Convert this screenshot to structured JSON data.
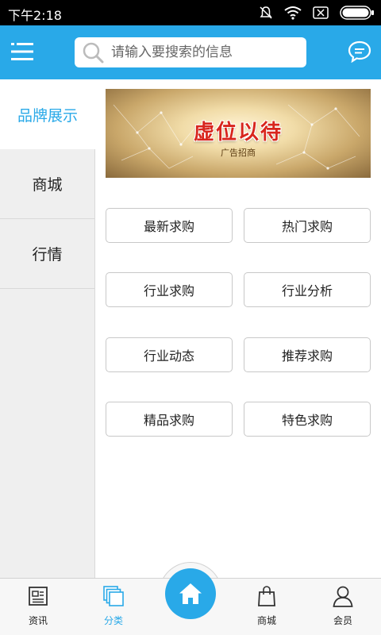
{
  "status_bar": {
    "time": "下午2:18",
    "battery_icon": "battery-icon",
    "wifi_icon": "wifi-icon",
    "mute_icon": "bell-off-icon",
    "sim_icon": "sim-off-icon"
  },
  "header": {
    "search": {
      "placeholder": "请输入要搜索的信息"
    },
    "menu_icon": "menu-icon",
    "message_icon": "chat-bubble-icon"
  },
  "sidebar": {
    "items": [
      {
        "label": "品牌展示",
        "active": true
      },
      {
        "label": "商城",
        "active": false
      },
      {
        "label": "行情",
        "active": false
      }
    ]
  },
  "banner": {
    "title": "虚位以待",
    "subtitle": "广告招商"
  },
  "categories": [
    {
      "label": "最新求购"
    },
    {
      "label": "热门求购"
    },
    {
      "label": "行业求购"
    },
    {
      "label": "行业分析"
    },
    {
      "label": "行业动态"
    },
    {
      "label": "推荐求购"
    },
    {
      "label": "精品求购"
    },
    {
      "label": "特色求购"
    }
  ],
  "tabbar": {
    "items": [
      {
        "label": "资讯",
        "icon": "news-icon",
        "active": false
      },
      {
        "label": "分类",
        "icon": "category-icon",
        "active": true
      },
      {
        "label": "",
        "icon": "home-icon",
        "active": false
      },
      {
        "label": "商城",
        "icon": "shopping-bag-icon",
        "active": false
      },
      {
        "label": "会员",
        "icon": "user-icon",
        "active": false
      }
    ]
  },
  "colors": {
    "accent": "#29a9e8",
    "sidebar_bg": "#efefef",
    "banner_title": "#d8261d"
  }
}
